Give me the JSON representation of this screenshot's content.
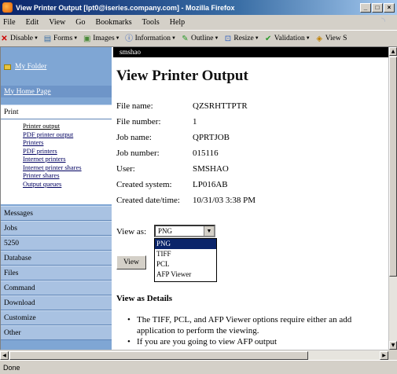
{
  "window": {
    "title": "View Printer Output [lpt0@iseries.company.com] - Mozilla Firefox"
  },
  "menubar": [
    "File",
    "Edit",
    "View",
    "Go",
    "Bookmarks",
    "Tools",
    "Help"
  ],
  "toolbar": [
    "Disable",
    "Forms",
    "Images",
    "Information",
    "Outline",
    "Resize",
    "Validation",
    "View S"
  ],
  "sidebar": {
    "my_folder": "My Folder",
    "my_home_page": "My Home Page",
    "print": "Print",
    "print_items": [
      "Printer output",
      "PDF printer output",
      "Printers",
      "PDF printers",
      "Internet printers",
      "Internet printer shares",
      "Printer shares",
      "Output queues"
    ],
    "sections": [
      "Messages",
      "Jobs",
      "5250",
      "Database",
      "Files",
      "Command",
      "Download",
      "Customize",
      "Other"
    ]
  },
  "main": {
    "user": "smshao",
    "title": "View Printer Output",
    "fields": [
      {
        "label": "File name:",
        "value": "QZSRHTTPTR"
      },
      {
        "label": "File number:",
        "value": "1"
      },
      {
        "label": "Job name:",
        "value": "QPRTJOB"
      },
      {
        "label": "Job number:",
        "value": "015116"
      },
      {
        "label": "User:",
        "value": "SMSHAO"
      },
      {
        "label": "Created system:",
        "value": "LP016AB"
      },
      {
        "label": "Created date/time:",
        "value": "10/31/03 3:38 PM"
      }
    ],
    "view_as_label": "View as:",
    "view_as_value": "PNG",
    "view_as_options": [
      "PNG",
      "TIFF",
      "PCL",
      "AFP Viewer"
    ],
    "view_button": "View",
    "details_heading": "View as Details",
    "bullets": [
      "The TIFF, PCL, and AFP Viewer options require either an add",
      "application to perform the viewing.",
      "If you are you going to view AFP output"
    ]
  },
  "status": "Done"
}
